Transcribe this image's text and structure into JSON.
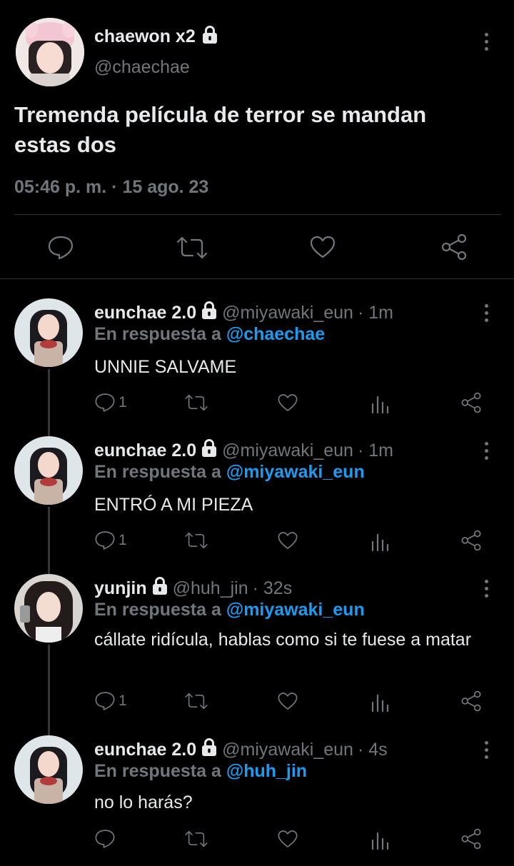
{
  "main_tweet": {
    "display_name": "chaewon x2",
    "handle": "@chaechae",
    "text": "Tremenda película de terror se mandan estas dos",
    "timestamp": "05:46 p. m. · 15 ago. 23"
  },
  "replies": [
    {
      "display_name": "eunchae 2.0",
      "handle": "@miyawaki_eun",
      "time": "· 1m",
      "reply_prefix": "En respuesta a",
      "reply_to": "@chaechae",
      "text": "UNNIE SALVAME",
      "reply_count": "1"
    },
    {
      "display_name": "eunchae 2.0",
      "handle": "@miyawaki_eun",
      "time": "· 1m",
      "reply_prefix": "En respuesta a",
      "reply_to": "@miyawaki_eun",
      "text": "ENTRÓ A MI PIEZA",
      "reply_count": "1"
    },
    {
      "display_name": "yunjin",
      "handle": "@huh_jin",
      "time": "· 32s",
      "reply_prefix": "En respuesta a",
      "reply_to": "@miyawaki_eun",
      "text": "cállate ridícula, hablas como si te fuese a matar",
      "reply_count": "1"
    },
    {
      "display_name": "eunchae 2.0",
      "handle": "@miyawaki_eun",
      "time": "· 4s",
      "reply_prefix": "En respuesta a",
      "reply_to": "@huh_jin",
      "text": "no lo harás?",
      "reply_count": ""
    }
  ],
  "icons": {
    "reply": "speech-bubble-icon",
    "retweet": "retweet-icon",
    "like": "heart-icon",
    "views": "bar-chart-icon",
    "share": "share-icon",
    "protected": "lock-icon",
    "more": "more-vertical-icon"
  },
  "colors": {
    "background": "#000000",
    "text": "#e7e9ea",
    "muted": "#71767b",
    "link": "#1d9bf0",
    "divider": "#2f3336"
  }
}
